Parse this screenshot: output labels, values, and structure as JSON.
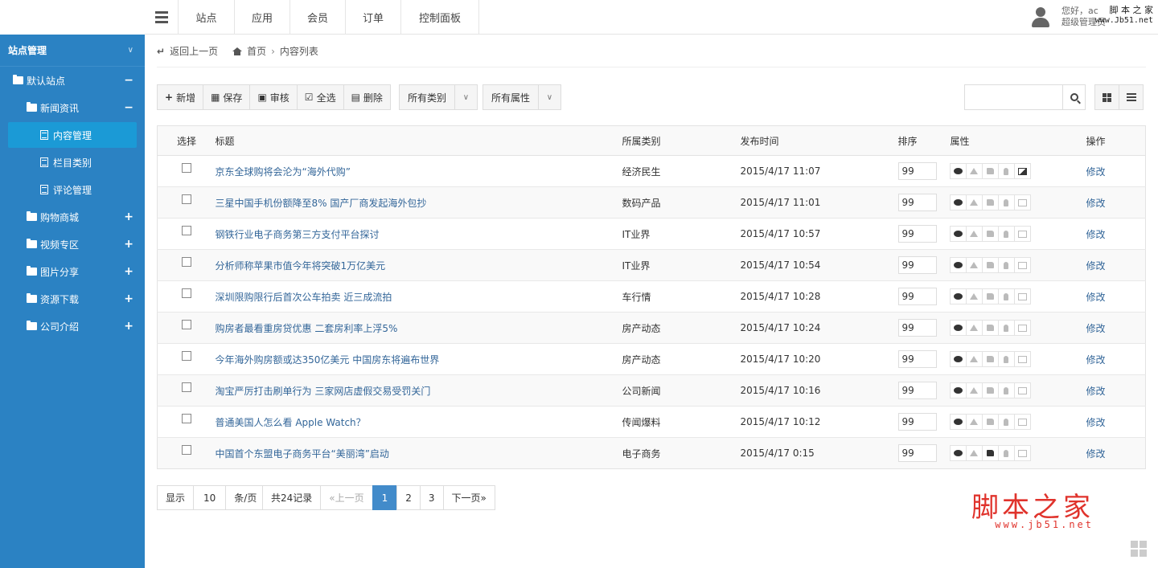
{
  "topnav": {
    "tabs": [
      "站点",
      "应用",
      "会员",
      "订单",
      "控制面板"
    ],
    "user_greeting": "您好，ac",
    "user_role": "超级管理员"
  },
  "sidebar": {
    "section_title": "站点管理",
    "items": [
      {
        "label": "默认站点",
        "toggle": "−"
      },
      {
        "label": "新闻资讯",
        "toggle": "−"
      },
      {
        "label": "内容管理"
      },
      {
        "label": "栏目类别"
      },
      {
        "label": "评论管理"
      },
      {
        "label": "购物商城",
        "toggle": "+"
      },
      {
        "label": "视频专区",
        "toggle": "+"
      },
      {
        "label": "图片分享",
        "toggle": "+"
      },
      {
        "label": "资源下载",
        "toggle": "+"
      },
      {
        "label": "公司介绍",
        "toggle": "+"
      }
    ]
  },
  "breadcrumb": {
    "back": "返回上一页",
    "home": "首页",
    "current": "内容列表"
  },
  "toolbar": {
    "add": "新增",
    "save": "保存",
    "audit": "审核",
    "select_all": "全选",
    "delete": "删除",
    "category_filter": "所有类别",
    "attr_filter": "所有属性"
  },
  "search": {
    "placeholder": ""
  },
  "table": {
    "headers": [
      "选择",
      "标题",
      "所属类别",
      "发布时间",
      "排序",
      "属性",
      "操作"
    ],
    "rows": [
      {
        "title": "京东全球购将会沦为“海外代购”",
        "category": "经济民生",
        "time": "2015/4/17 11:07",
        "sort": "99",
        "edit": "修改"
      },
      {
        "title": "三星中国手机份额降至8% 国产厂商发起海外包抄",
        "category": "数码产品",
        "time": "2015/4/17 11:01",
        "sort": "99",
        "edit": "修改"
      },
      {
        "title": "钢铁行业电子商务第三方支付平台探讨",
        "category": "IT业界",
        "time": "2015/4/17 10:57",
        "sort": "99",
        "edit": "修改"
      },
      {
        "title": "分析师称苹果市值今年将突破1万亿美元",
        "category": "IT业界",
        "time": "2015/4/17 10:54",
        "sort": "99",
        "edit": "修改"
      },
      {
        "title": "深圳限购限行后首次公车拍卖 近三成流拍",
        "category": "车行情",
        "time": "2015/4/17 10:28",
        "sort": "99",
        "edit": "修改"
      },
      {
        "title": "购房者最看重房贷优惠 二套房利率上浮5%",
        "category": "房产动态",
        "time": "2015/4/17 10:24",
        "sort": "99",
        "edit": "修改"
      },
      {
        "title": "今年海外购房额或达350亿美元 中国房东将遍布世界",
        "category": "房产动态",
        "time": "2015/4/17 10:20",
        "sort": "99",
        "edit": "修改"
      },
      {
        "title": "淘宝严厉打击刷单行为 三家网店虚假交易受罚关门",
        "category": "公司新闻",
        "time": "2015/4/17 10:16",
        "sort": "99",
        "edit": "修改"
      },
      {
        "title": "普通美国人怎么看 Apple Watch？",
        "category": "传闻爆料",
        "time": "2015/4/17 10:12",
        "sort": "99",
        "edit": "修改"
      },
      {
        "title": "中国首个东盟电子商务平台“美丽湾”启动",
        "category": "电子商务",
        "time": "2015/4/17 0:15",
        "sort": "99",
        "edit": "修改"
      }
    ]
  },
  "pagination": {
    "show": "显示",
    "per_page": "10",
    "unit": "条/页",
    "total": "共24记录",
    "prev": "«上一页",
    "pages": [
      "1",
      "2",
      "3"
    ],
    "next": "下一页»"
  },
  "watermark": {
    "top_line1": "脚 本 之 家",
    "top_line2": "www.Jb51.net",
    "brand": "脚本之家",
    "url": "www.jb51.net"
  }
}
